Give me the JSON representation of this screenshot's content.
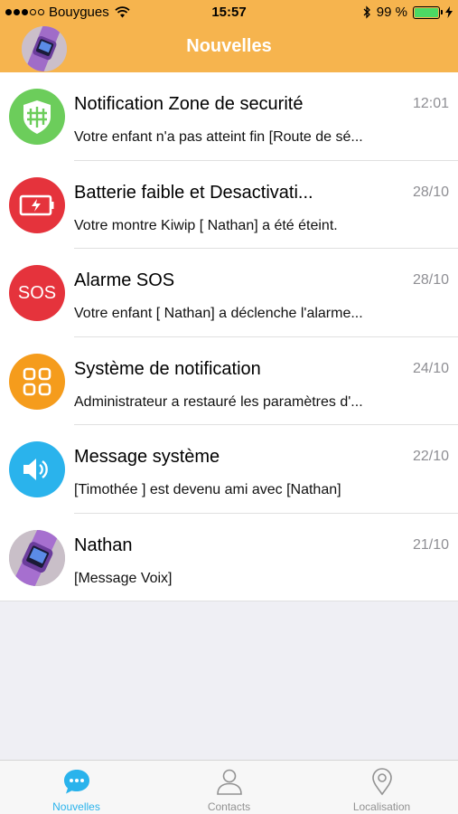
{
  "status_bar": {
    "carrier": "Bouygues",
    "time": "15:57",
    "battery_percent": "99 %",
    "battery_level": 0.99,
    "signal_bars": 3
  },
  "nav": {
    "title": "Nouvelles"
  },
  "colors": {
    "header": "#f6b44e",
    "accent": "#2ab3ec",
    "zone_icon": "#6ccd5b",
    "battery_icon": "#e5333c",
    "sos_icon": "#e5333c",
    "system_icon": "#f59c1c",
    "message_icon": "#2ab3ec"
  },
  "messages": [
    {
      "icon": "shield-fence-icon",
      "title": "Notification Zone de securité",
      "time": "12:01",
      "preview": "Votre enfant n'a pas atteint fin [Route de sé..."
    },
    {
      "icon": "low-battery-icon",
      "title": "Batterie faible et Desactivati...",
      "time": "28/10",
      "preview": "Votre montre Kiwip [ Nathan] a été éteint."
    },
    {
      "icon": "sos-icon",
      "title": "Alarme SOS",
      "time": "28/10",
      "preview": "Votre enfant [ Nathan] a déclenche l'alarme...",
      "icon_text": "SOS"
    },
    {
      "icon": "grid-icon",
      "title": "Système de notification",
      "time": "24/10",
      "preview": "Administrateur a restauré les paramètres d'..."
    },
    {
      "icon": "speaker-icon",
      "title": "Message système",
      "time": "22/10",
      "preview": "[Timothée ] est devenu ami avec [Nathan]"
    },
    {
      "icon": "avatar",
      "title": "Nathan",
      "time": "21/10",
      "preview": "[Message Voix]"
    }
  ],
  "tabs": [
    {
      "label": "Nouvelles",
      "icon": "chat-bubble-icon",
      "active": true
    },
    {
      "label": "Contacts",
      "icon": "person-icon",
      "active": false
    },
    {
      "label": "Localisation",
      "icon": "location-pin-icon",
      "active": false
    }
  ]
}
